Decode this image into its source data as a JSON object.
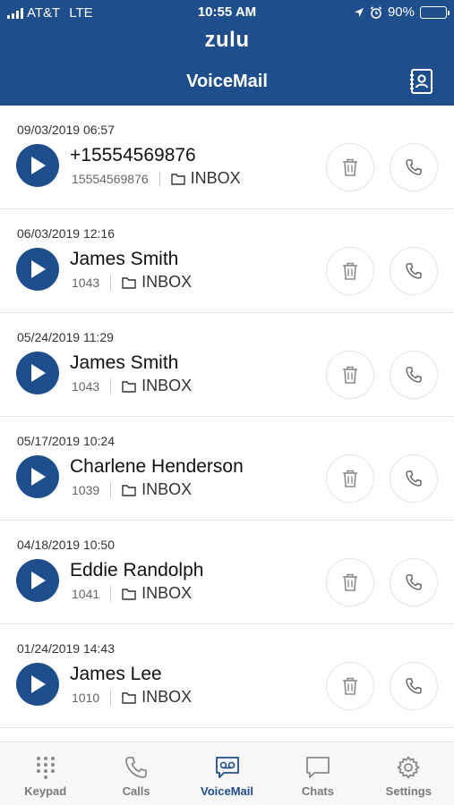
{
  "status": {
    "carrier": "AT&T",
    "network": "LTE",
    "time": "10:55 AM",
    "battery": "90%",
    "battery_level": 0.9
  },
  "header": {
    "logo": "zulu",
    "title": "VoiceMail",
    "contacts_icon": "contacts-book-icon"
  },
  "voicemails": [
    {
      "date": "09/03/2019 06:57",
      "name": "+15554569876",
      "ext": "15554569876",
      "folder": "INBOX"
    },
    {
      "date": "06/03/2019 12:16",
      "name": "James Smith",
      "ext": "1043",
      "folder": "INBOX"
    },
    {
      "date": "05/24/2019 11:29",
      "name": "James Smith",
      "ext": "1043",
      "folder": "INBOX"
    },
    {
      "date": "05/17/2019 10:24",
      "name": "Charlene Henderson",
      "ext": "1039",
      "folder": "INBOX"
    },
    {
      "date": "04/18/2019 10:50",
      "name": "Eddie Randolph",
      "ext": "1041",
      "folder": "INBOX"
    },
    {
      "date": "01/24/2019 14:43",
      "name": "James Lee",
      "ext": "1010",
      "folder": "INBOX"
    }
  ],
  "tabs": [
    {
      "label": "Keypad",
      "icon": "keypad-icon"
    },
    {
      "label": "Calls",
      "icon": "phone-icon"
    },
    {
      "label": "VoiceMail",
      "icon": "voicemail-icon",
      "active": true
    },
    {
      "label": "Chats",
      "icon": "chat-icon"
    },
    {
      "label": "Settings",
      "icon": "gear-icon"
    }
  ],
  "colors": {
    "brand": "#1f4e8c",
    "inactive_tab": "#7a7a7a"
  }
}
